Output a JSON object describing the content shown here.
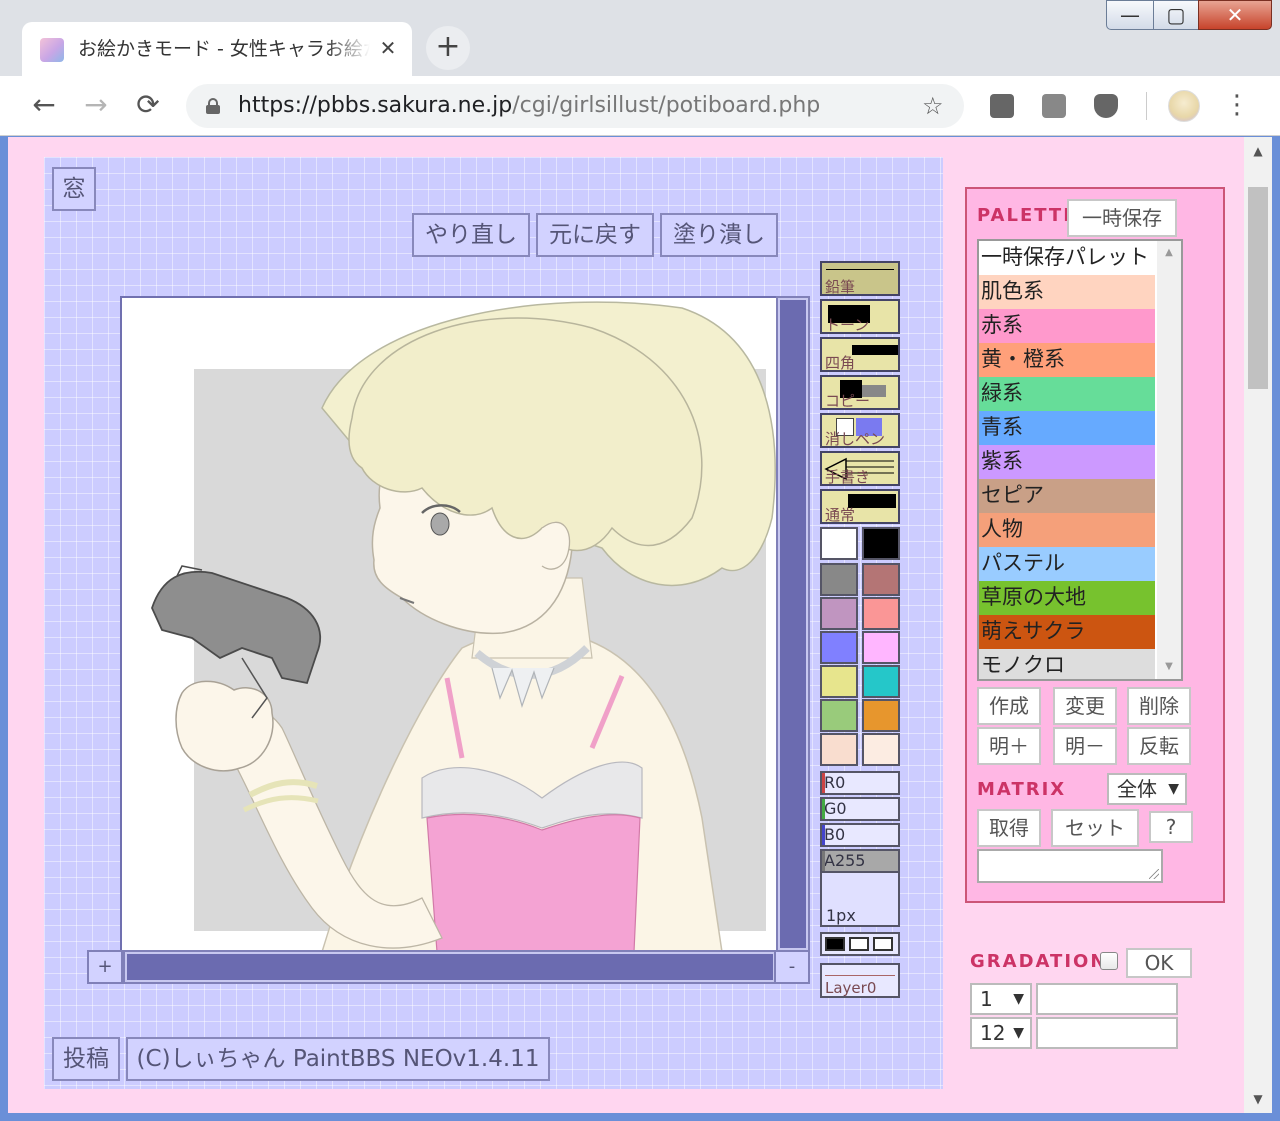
{
  "browser": {
    "tab_title": "お絵かきモード - 女性キャラお絵かき",
    "tab_close": "✕",
    "new_tab": "+",
    "url_host": "https://pbbs.sakura.ne.jp",
    "url_path": "/cgi/girlsillust/potiboard.php",
    "back": "←",
    "forward": "→",
    "reload": "⟳",
    "bookmark_star": "☆",
    "menu": "⋮",
    "window_min": "—",
    "window_max": "▢",
    "window_close": "✕"
  },
  "neo": {
    "window_button": "窓",
    "redo": "やり直し",
    "undo": "元に戻す",
    "fill": "塗り潰し",
    "post": "投稿",
    "credit": "(C)しぃちゃん PaintBBS NEOv1.4.11",
    "zoom_in": "+",
    "zoom_out": "-",
    "tools": [
      "鉛筆",
      "トーン",
      "四角",
      "コピー",
      "消しペン",
      "手書き",
      "通常"
    ],
    "colors": [
      [
        "#ffffff",
        "#000000"
      ],
      [
        "#888888",
        "#b47575"
      ],
      [
        "#c095c0",
        "#fa9696"
      ],
      [
        "#8080ff",
        "#ffb6ff"
      ],
      [
        "#e7e58d",
        "#25c7c9"
      ],
      [
        "#99cb7b",
        "#e7962d"
      ],
      [
        "#f9ddcf",
        "#fcece2"
      ]
    ],
    "rgba": [
      {
        "label": "R0",
        "accent": "#cc4444"
      },
      {
        "label": "G0",
        "accent": "#44aa44"
      },
      {
        "label": "B0",
        "accent": "#4444cc"
      },
      {
        "label": "A255",
        "accent": "#777777"
      }
    ],
    "pen_size": "1px",
    "layer": "Layer0"
  },
  "palette": {
    "title": "PALETTE",
    "save_button": "一時保存",
    "items": [
      {
        "label": "一時保存パレット",
        "color": "#ffffff"
      },
      {
        "label": "肌色系",
        "color": "#ffd4c0"
      },
      {
        "label": "赤系",
        "color": "#ff99cc"
      },
      {
        "label": "黄・橙系",
        "color": "#ffa07a"
      },
      {
        "label": "緑系",
        "color": "#66dd99"
      },
      {
        "label": "青系",
        "color": "#66aaff"
      },
      {
        "label": "紫系",
        "color": "#cc99ff"
      },
      {
        "label": "セピア",
        "color": "#c9a087"
      },
      {
        "label": "人物",
        "color": "#f5a07a"
      },
      {
        "label": "パステル",
        "color": "#99ccff"
      },
      {
        "label": "草原の大地",
        "color": "#77c22e"
      },
      {
        "label": "萌えサクラ",
        "color": "#cc5511"
      },
      {
        "label": "モノクロ",
        "color": "#dddddd"
      }
    ],
    "actions": [
      "作成",
      "変更",
      "削除",
      "明＋",
      "明－",
      "反転"
    ]
  },
  "matrix": {
    "title": "MATRIX",
    "scope": "全体",
    "get": "取得",
    "set": "セット",
    "help": "?"
  },
  "gradation": {
    "title": "GRADATION",
    "ok": "OK",
    "step1": "1",
    "step2": "12"
  }
}
